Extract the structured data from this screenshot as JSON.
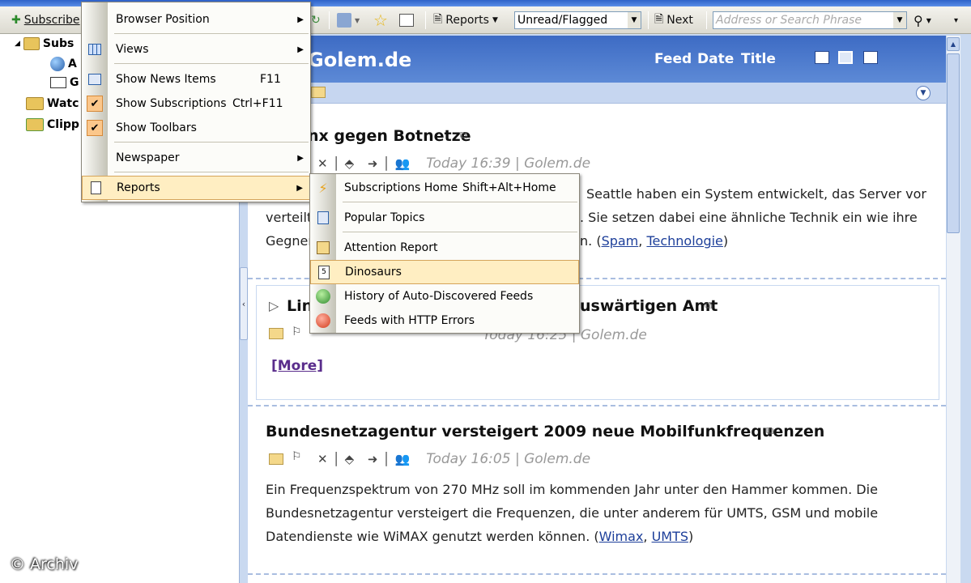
{
  "toolbar": {
    "subscribe_label": "Subscribe",
    "reports_label": "Reports",
    "filter_value": "Unread/Flagged",
    "next_label": "Next",
    "search_placeholder": "Address or Search Phrase"
  },
  "tree": {
    "items": [
      {
        "label": "Subs"
      },
      {
        "label": "A"
      },
      {
        "label": "G"
      },
      {
        "label": "Watc"
      },
      {
        "label": "Clipp"
      }
    ]
  },
  "feed": {
    "title": "Golem.de",
    "sort_feed": "Feed",
    "sort_date": "Date",
    "sort_title": "Title"
  },
  "articles": [
    {
      "title": "nx gegen Botnetze",
      "meta": "Today 16:39 | Golem.de",
      "body_lines": [
        "Seattle haben ein System entwickelt, das Server vor",
        "verteilt",
        ". Sie setzen dabei eine ähnliche Technik ein wie ihre",
        "Gegner",
        "n. ("
      ],
      "tags": [
        "Spam",
        "Technologie"
      ]
    },
    {
      "title_left": "Lin",
      "title_right": "uswärtigen Amt",
      "meta": "Today 16:25 | Golem.de",
      "more": "[More]"
    },
    {
      "title": "Bundesnetzagentur versteigert 2009 neue Mobilfunkfrequenzen",
      "meta": "Today 16:05 | Golem.de",
      "body_lines": [
        "Ein Frequenzspektrum von 270 MHz soll im kommenden Jahr unter den Hammer kommen. Die",
        "Bundesnetzagentur versteigert die Frequenzen, die unter anderem für UMTS, GSM und mobile",
        "Datendienste wie WiMAX genutzt werden können. ("
      ],
      "tags": [
        "Wimax",
        "UMTS"
      ]
    }
  ],
  "view_menu": {
    "items": [
      {
        "label": "Browser Position",
        "shortcut": "",
        "submenu": true
      },
      {
        "label": "Views",
        "shortcut": "",
        "submenu": true
      },
      {
        "label": "Show News Items",
        "shortcut": "F11"
      },
      {
        "label": "Show Subscriptions",
        "shortcut": "Ctrl+F11",
        "checked": true
      },
      {
        "label": "Show Toolbars",
        "shortcut": "",
        "checked": true
      },
      {
        "label": "Newspaper",
        "shortcut": "",
        "submenu": true
      },
      {
        "label": "Reports",
        "shortcut": "",
        "submenu": true
      }
    ]
  },
  "reports_menu": {
    "items": [
      {
        "label": "Subscriptions Home",
        "shortcut": "Shift+Alt+Home"
      },
      {
        "label": "Popular Topics",
        "shortcut": ""
      },
      {
        "label": "Attention Report",
        "shortcut": ""
      },
      {
        "label": "Dinosaurs",
        "shortcut": ""
      },
      {
        "label": "History of Auto-Discovered Feeds",
        "shortcut": ""
      },
      {
        "label": "Feeds with HTTP Errors",
        "shortcut": ""
      }
    ]
  },
  "watermark": "© Archiv",
  "colors": {
    "header_blue": "#3d6bc4",
    "menu_highlight": "#ffeec2",
    "check_bg": "#fbc78b",
    "link": "#1d3f9a"
  }
}
